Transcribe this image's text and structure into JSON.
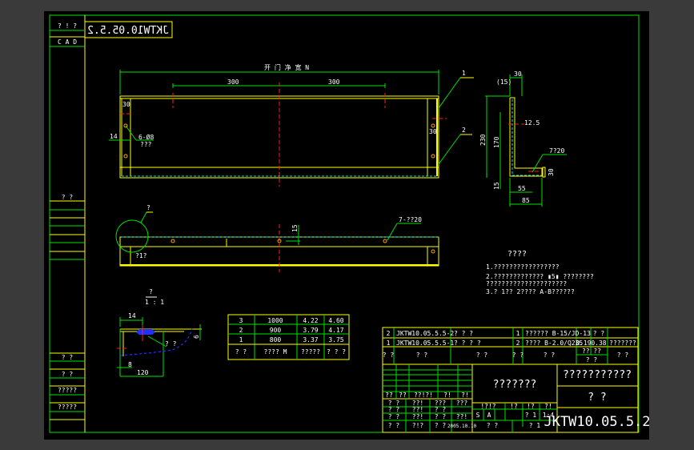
{
  "colors": {
    "background": "#000000",
    "frame": "#00e000",
    "outline": "#ffff00",
    "centerline": "#ff2020",
    "hidden": "#00e0e0",
    "text": "#ffffff"
  },
  "left_strip": {
    "top_label": "? ! ?",
    "cad_label": "C A D",
    "mirrored_code": "JKTW10.05.5.2",
    "label_a": "?   ?",
    "label_b": "?   ?",
    "label_c": "?   ?",
    "label_d": "?????",
    "label_e": "?????"
  },
  "front_view": {
    "overall_dim": "开 门 净 宽  N",
    "dim_left": "300",
    "dim_right": "300",
    "dim_30_left": "30",
    "dim_30_right": "30",
    "dim_14": "14",
    "holes_label": "6-Ø8",
    "holes_sub": "???",
    "callout_1": "1",
    "callout_2": "2"
  },
  "plan_view": {
    "detail_callout": "?",
    "holes_label": "7-??20",
    "dim_15": "15",
    "sub_label": "?1?"
  },
  "section_view": {
    "dim_30_top": "30",
    "dim_15_paren": "(15)",
    "dim_230": "230",
    "dim_170": "170",
    "dim_12_5": "12.5",
    "holes_label": "7?20",
    "dim_30_side": "30",
    "dim_15_bottom": "15",
    "dim_55": "55",
    "dim_85": "85"
  },
  "detail_view": {
    "title": "?",
    "scale": "1 : 1",
    "dim_14": "14",
    "dim_8": "8",
    "dim_120": "120",
    "label": "? ?",
    "dim_6": "6"
  },
  "size_table": {
    "rows": [
      [
        "3",
        "1000",
        "4.22",
        "4.60"
      ],
      [
        "2",
        "900",
        "3.79",
        "4.17"
      ],
      [
        "1",
        "800",
        "3.37",
        "3.75"
      ]
    ],
    "header": [
      "?  ?",
      "????  M",
      "?????",
      "?  ?  ?"
    ]
  },
  "notes": {
    "title": "????",
    "lines": [
      "1.?????????????????",
      "2.????????????? ▮5▮ ????????",
      "  ?????????????????????",
      "3.? 1?? 2???? A-B??????"
    ]
  },
  "title_block": {
    "parts": [
      [
        "2",
        "JKTW10.05.5.5-2",
        "? ? ?",
        "1",
        "?????? B-15/JD-13",
        "",
        "? ?",
        ""
      ],
      [
        "1",
        "JKTW10.05.5.5-1",
        "? ? ? ?",
        "2",
        "???? B-2.0/Q235",
        "0.19",
        "0.38",
        "???????"
      ]
    ],
    "parts_header": [
      "?\n?",
      "?         ?",
      "?        ?",
      "?\n?",
      "?         ?",
      "?? ??",
      "?  ?",
      "?    ?"
    ],
    "sign_labels": [
      "??",
      "??",
      "??!?!",
      "?!",
      "?!"
    ],
    "sign_rows": [
      [
        "? ?",
        "??!",
        "???",
        "???"
      ],
      [
        "? ?",
        "??!",
        "? ?",
        ""
      ],
      [
        "? ?",
        "??!",
        "? ?",
        "??!"
      ],
      [
        "? ?",
        "?!?",
        "? ?",
        "2005.10.10"
      ]
    ],
    "drawing_name": "???????",
    "company": "???????????",
    "material": "?            ?",
    "stage_labels": [
      "!?!?",
      "!?",
      "!?",
      "?!"
    ],
    "stage_values": [
      "S",
      "A",
      "",
      "",
      "? 1",
      "1:4"
    ],
    "sheet_labels": [
      "?      ?",
      "?      1"
    ],
    "drawing_no": "JKTW10.05.5.2"
  }
}
